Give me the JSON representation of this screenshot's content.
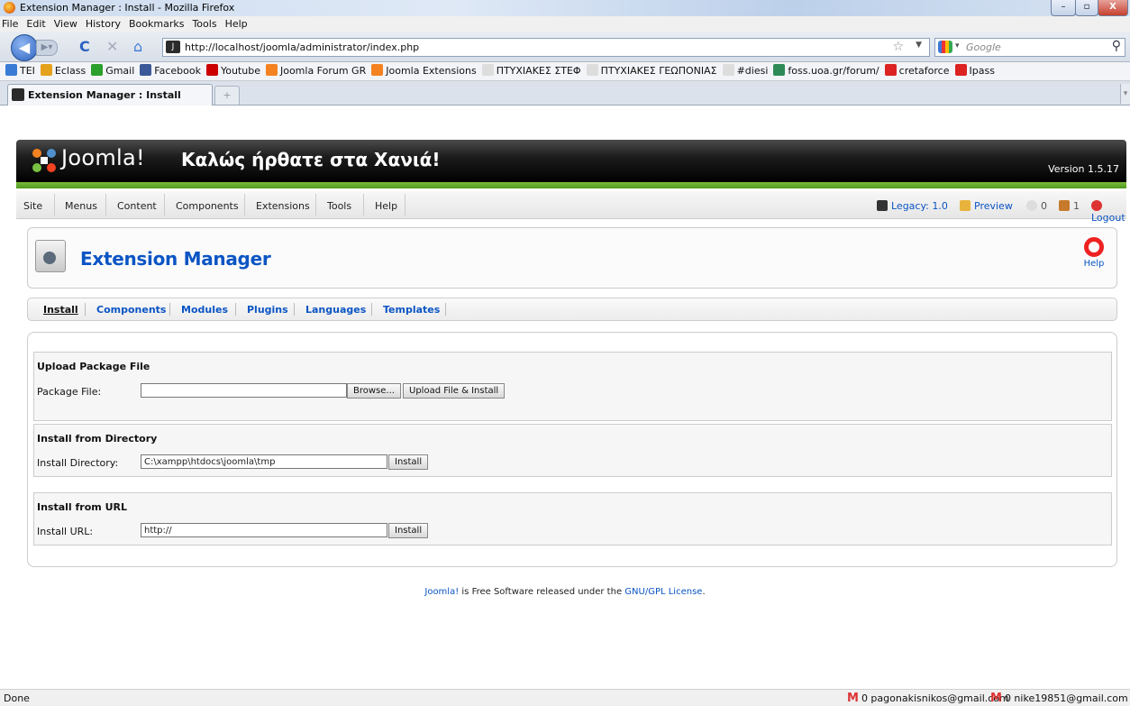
{
  "window": {
    "title": "Extension Manager : Install - Mozilla Firefox",
    "buttons": [
      "–",
      "▫",
      "X"
    ]
  },
  "menubar": [
    "File",
    "Edit",
    "View",
    "History",
    "Bookmarks",
    "Tools",
    "Help"
  ],
  "nav": {
    "url": "http://localhost/joomla/administrator/index.php",
    "search_placeholder": "Google"
  },
  "bookmarks": [
    {
      "label": "TEI",
      "color": "#3a7bd5"
    },
    {
      "label": "Eclass",
      "color": "#e4a11b"
    },
    {
      "label": "Gmail",
      "color": "#2ca02c"
    },
    {
      "label": "Facebook",
      "color": "#3b5998"
    },
    {
      "label": "Youtube",
      "color": "#c00"
    },
    {
      "label": "Joomla Forum GR",
      "color": "#f58220"
    },
    {
      "label": "Joomla Extensions",
      "color": "#f58220"
    },
    {
      "label": "ΠΤΥΧΙΑΚΕΣ ΣΤΕΦ",
      "color": "#ddd"
    },
    {
      "label": "ΠΤΥΧΙΑΚΕΣ ΓΕΩΠΟΝΙΑΣ",
      "color": "#ddd"
    },
    {
      "label": "#diesi",
      "color": "#ddd"
    },
    {
      "label": "foss.uoa.gr/forum/",
      "color": "#2e8b57"
    },
    {
      "label": "cretaforce",
      "color": "#d22"
    },
    {
      "label": "Ipass",
      "color": "#d22"
    }
  ],
  "tab": {
    "label": "Extension Manager : Install",
    "new": "+"
  },
  "joomla": {
    "brand": "Joomla!",
    "site_name": "Καλώς ήρθατε στα Χανιά!",
    "version": "Version 1.5.17",
    "menu": [
      "Site",
      "Menus",
      "Content",
      "Components",
      "Extensions",
      "Tools",
      "Help"
    ],
    "status": {
      "legacy": "Legacy: 1.0",
      "preview": "Preview",
      "messages": "0",
      "users": "1",
      "logout": "Logout"
    },
    "page_title": "Extension Manager",
    "help": "Help",
    "submenu": [
      "Install",
      "Components",
      "Modules",
      "Plugins",
      "Languages",
      "Templates"
    ],
    "upload": {
      "heading": "Upload Package File",
      "label": "Package File:",
      "value": "",
      "browse": "Browse...",
      "button": "Upload File & Install"
    },
    "directory": {
      "heading": "Install from Directory",
      "label": "Install Directory:",
      "value": "C:\\xampp\\htdocs\\joomla\\tmp",
      "button": "Install"
    },
    "url": {
      "heading": "Install from URL",
      "label": "Install URL:",
      "value": "http://",
      "button": "Install"
    },
    "footer": {
      "link1": "Joomla!",
      "text1": " is Free Software released under the ",
      "link2": "GNU/GPL License",
      "text2": "."
    }
  },
  "statusbar": {
    "text": "Done",
    "mail1": "0 pagonakisnikos@gmail.com",
    "mail2": "0 nike19851@gmail.com"
  },
  "colors": {
    "accent": "#0b55c4",
    "green_bar": "#6fb334",
    "header": "#000000"
  }
}
